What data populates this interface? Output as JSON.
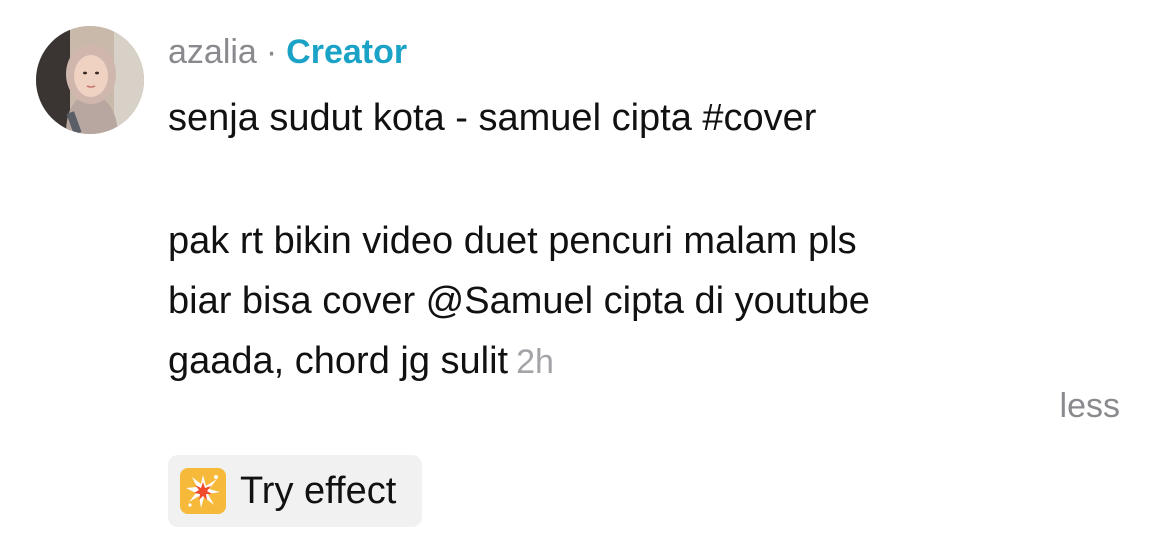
{
  "post": {
    "username": "azalia",
    "separator": "·",
    "role_badge": "Creator",
    "caption_lines": [
      "senja sudut kota - samuel cipta #cover",
      "pak rt bikin video duet pencuri malam pls",
      "biar bisa cover @Samuel cipta di youtube",
      "gaada, chord jg sulit"
    ],
    "timestamp": "2h",
    "collapse_label": "less"
  },
  "effect_button": {
    "label": "Try effect",
    "icon": "sparkle-burst-icon"
  },
  "colors": {
    "creator_accent": "#1aa3c6",
    "muted_text": "#8a8a8e",
    "timestamp": "#a4a4a8",
    "effect_icon_bg": "#f6b93a",
    "button_bg": "#f1f1f2"
  }
}
